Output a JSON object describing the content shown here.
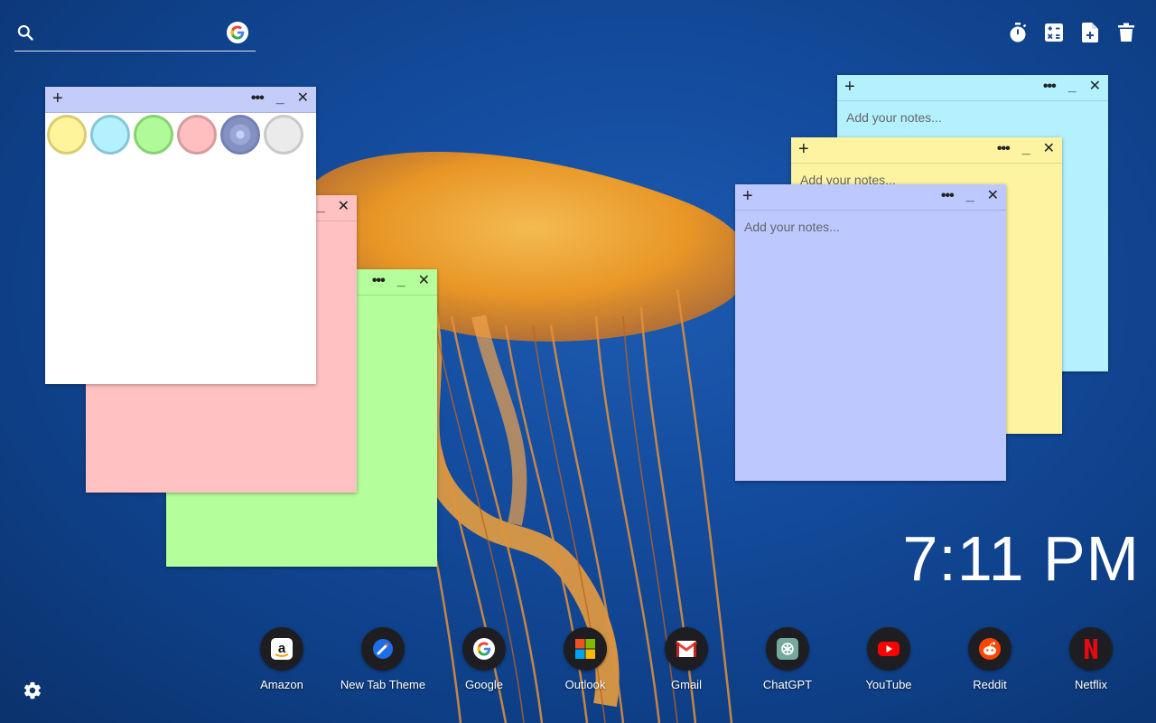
{
  "search": {
    "placeholder": "",
    "engine_icon": "google-g-icon"
  },
  "toolbar": {
    "tools": [
      "timer-icon",
      "calculator-icon",
      "new-note-icon",
      "trash-icon"
    ]
  },
  "palette": {
    "colors": [
      "#fdf49c",
      "#b3f1ff",
      "#b0fa99",
      "#ffbfc0",
      "#9ba8d6",
      "#ebebeb"
    ],
    "selected_index": 4
  },
  "notes": [
    {
      "id": "cyan",
      "color": "#b4f1ff",
      "placeholder": "Add your notes..."
    },
    {
      "id": "yellow",
      "color": "#fdf3a1",
      "placeholder": "Add your notes..."
    },
    {
      "id": "periwinkle",
      "color": "#bdc8ff",
      "placeholder": "Add your notes..."
    },
    {
      "id": "pink",
      "color": "#ffc1c1",
      "placeholder": ""
    },
    {
      "id": "green",
      "color": "#b4fe9b",
      "placeholder": ""
    },
    {
      "id": "white",
      "color": "#ffffff",
      "placeholder": ""
    }
  ],
  "note_controls": {
    "add": "+",
    "more": "•••",
    "minimize": "_",
    "close": "✕"
  },
  "clock": {
    "time": "7:11 PM"
  },
  "dock": {
    "apps": [
      {
        "label": "Amazon",
        "icon": "amazon-icon"
      },
      {
        "label": "New Tab Theme",
        "icon": "new-tab-theme-icon"
      },
      {
        "label": "Google",
        "icon": "google-icon"
      },
      {
        "label": "Outlook",
        "icon": "outlook-icon"
      },
      {
        "label": "Gmail",
        "icon": "gmail-icon"
      },
      {
        "label": "ChatGPT",
        "icon": "chatgpt-icon"
      },
      {
        "label": "YouTube",
        "icon": "youtube-icon"
      },
      {
        "label": "Reddit",
        "icon": "reddit-icon"
      },
      {
        "label": "Netflix",
        "icon": "netflix-icon"
      }
    ]
  },
  "settings": {
    "icon": "gear-icon"
  }
}
